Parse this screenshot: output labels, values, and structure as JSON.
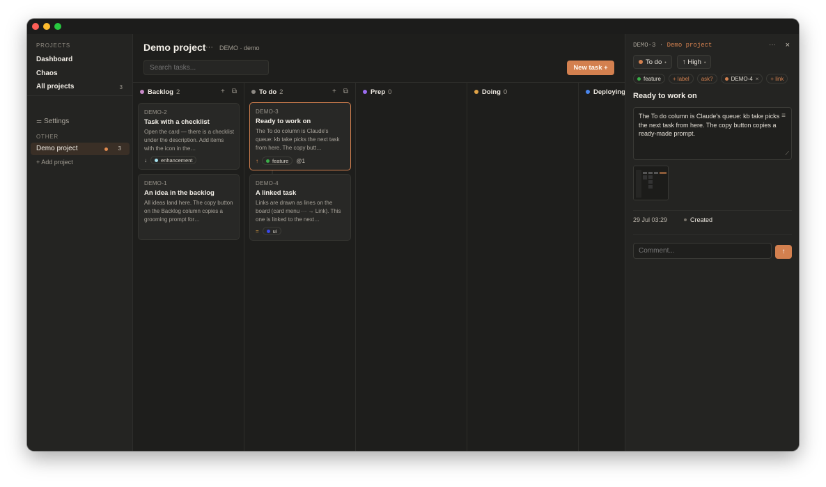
{
  "sidebar": {
    "projects_label": "PROJECTS",
    "dashboard": "Dashboard",
    "chaos": "Chaos",
    "all_projects": "All projects",
    "all_projects_count": "3",
    "settings": "Settings",
    "other_label": "OTHER",
    "active_project": "Demo project",
    "active_project_count": "3",
    "add_project": "+ Add project"
  },
  "header": {
    "title": "Demo project",
    "more": "···",
    "subtitle": "DEMO · demo",
    "search_placeholder": "Search tasks...",
    "new_task": "New task +"
  },
  "columns": [
    {
      "name": "Backlog",
      "count": "2",
      "color": "#c98bc9"
    },
    {
      "name": "To do",
      "count": "2",
      "color": "#8e8a84"
    },
    {
      "name": "Prep",
      "count": "0",
      "color": "#9b6cf0"
    },
    {
      "name": "Doing",
      "count": "0",
      "color": "#e0a347"
    },
    {
      "name": "Deploying",
      "count": "",
      "color": "#4a86ee"
    }
  ],
  "cards": {
    "demo2": {
      "id": "DEMO-2",
      "title": "Task with a checklist",
      "desc": "Open the card — there is a checklist under the description. Add items with the icon in the…",
      "priority_icon": "↓",
      "label": "enhancement",
      "label_color": "#a6e1ee"
    },
    "demo1": {
      "id": "DEMO-1",
      "title": "An idea in the backlog",
      "desc": "All ideas land here. The copy button on the Backlog column copies a grooming prompt for…"
    },
    "demo3": {
      "id": "DEMO-3",
      "title": "Ready to work on",
      "desc": "The To do column is Claude's queue: kb take picks the next task from here. The copy butt…",
      "priority_icon": "↑",
      "label": "feature",
      "label_color": "#3bb04a",
      "links": "1"
    },
    "demo4": {
      "id": "DEMO-4",
      "title": "A linked task",
      "desc": "Links are drawn as lines on the board (card menu ··· → Link). This one is linked to the next…",
      "priority_icon": "=",
      "label": "ui",
      "label_color": "#3a49e8"
    }
  },
  "panel": {
    "task_id": "DEMO-3",
    "separator": "·",
    "project": "Demo project",
    "status": "To do",
    "priority": "↑ High",
    "tags": {
      "feature": "feature",
      "add_label": "+ label",
      "ask": "ask?",
      "linked": "DEMO-4",
      "add_link": "+ link"
    },
    "title": "Ready to work on",
    "description": "The To do column is Claude's queue: kb take picks the next task from here. The copy button copies a ready-made prompt.",
    "date": "29 Jul 03:29",
    "created": "Created",
    "comment_placeholder": "Comment...",
    "send_icon": "↑"
  },
  "colors": {
    "accent": "#d3804f",
    "background": "#1e1e1c",
    "sidebar": "#242422"
  }
}
